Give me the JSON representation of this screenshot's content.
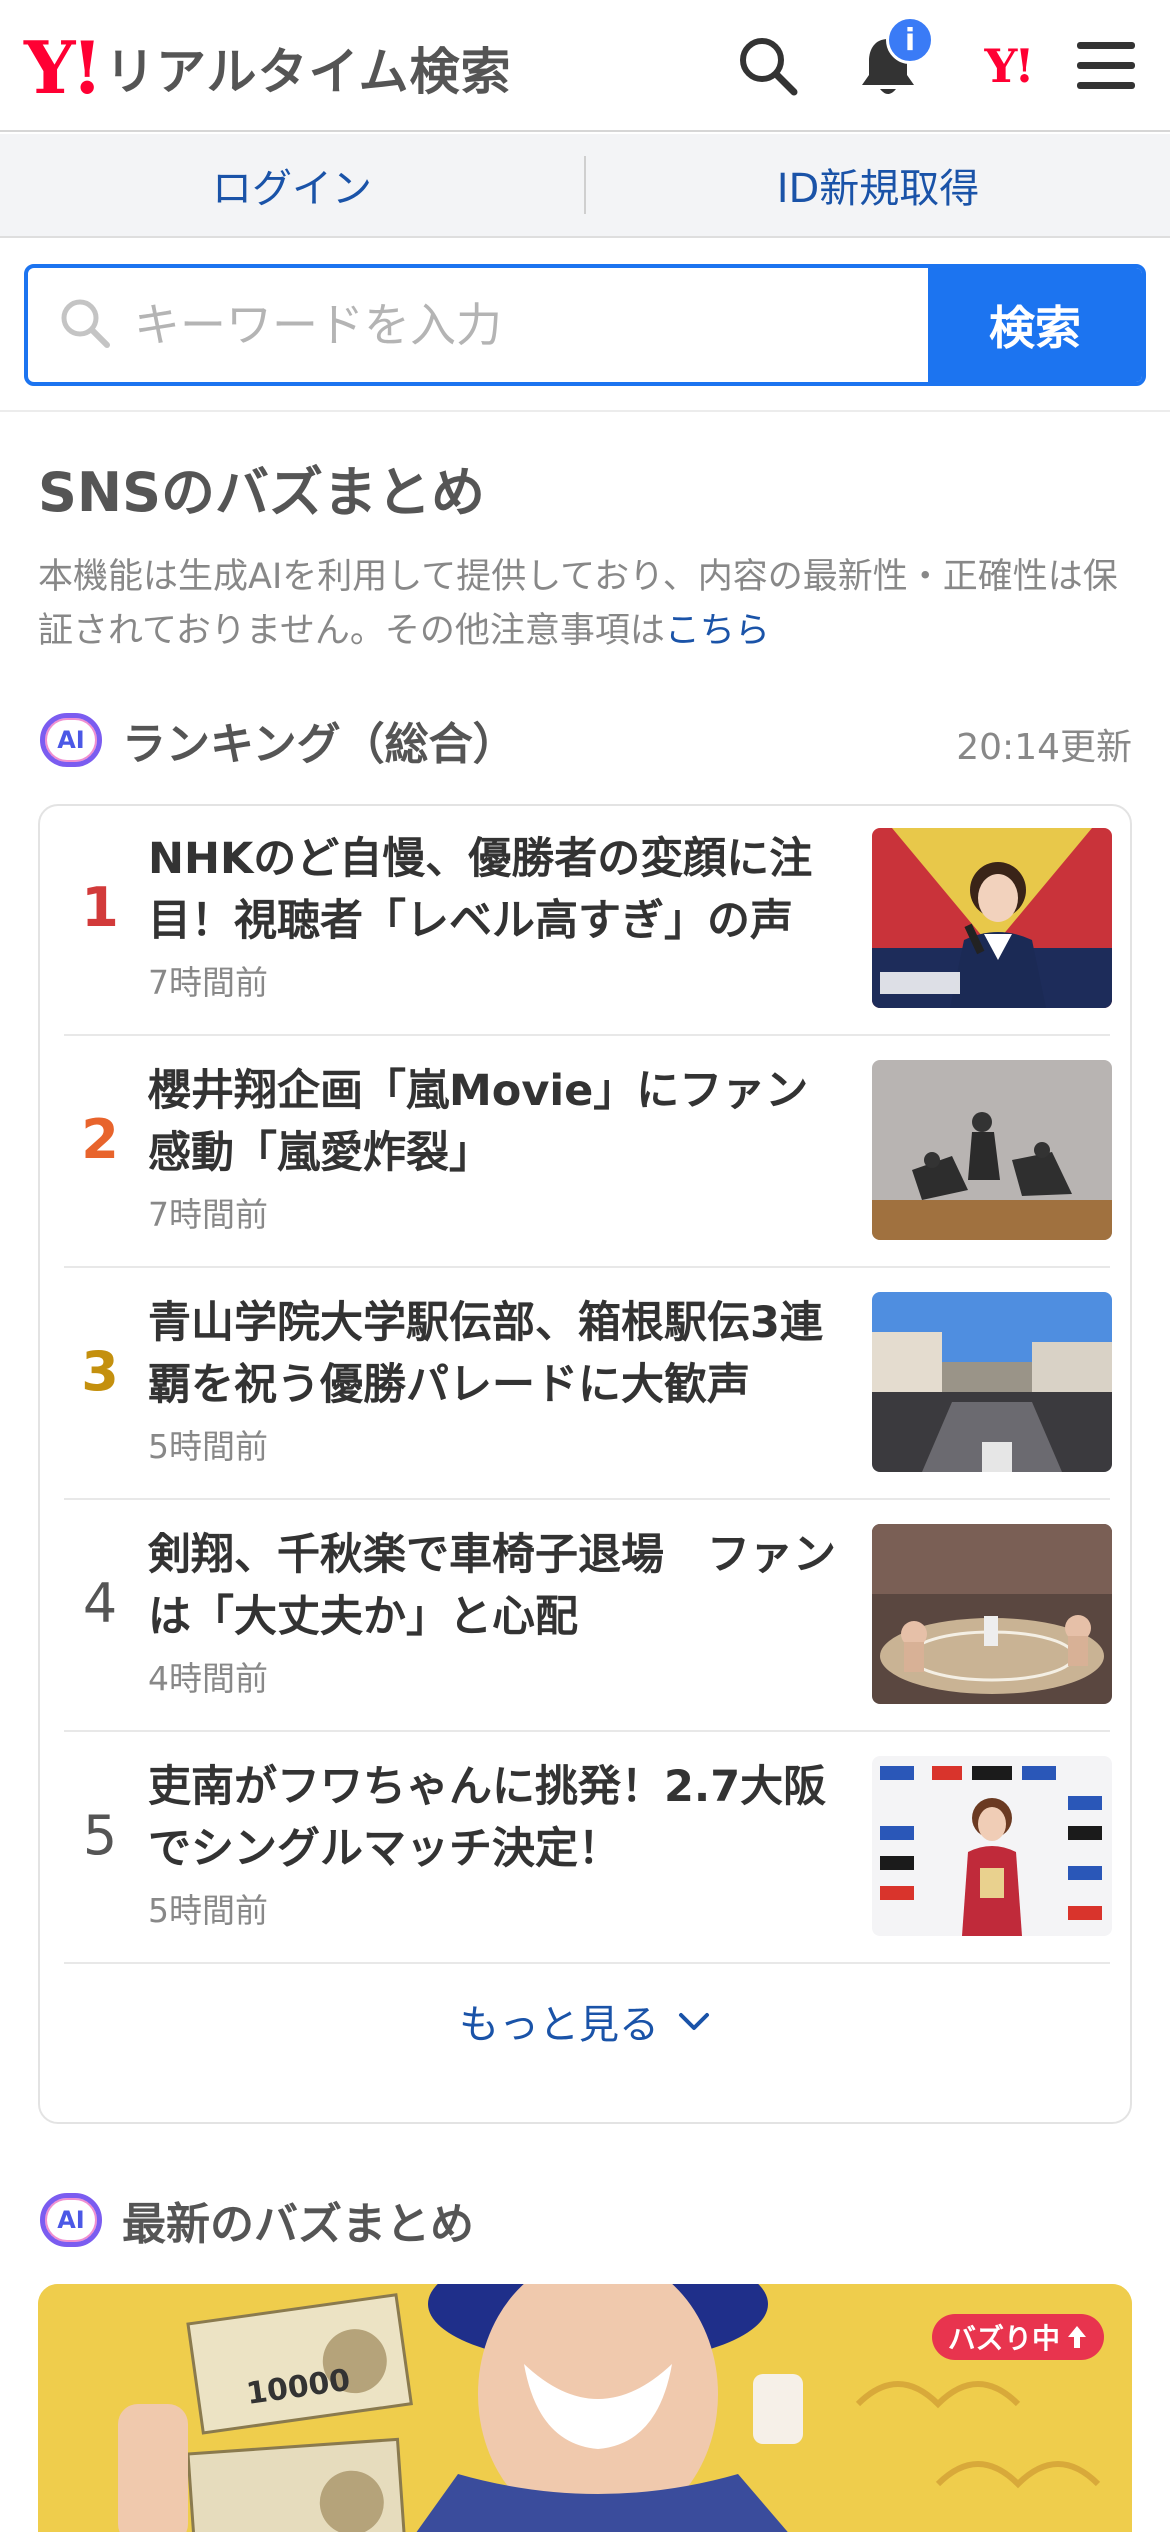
{
  "header": {
    "logo_mark": "Y!",
    "logo_text": "リアルタイム検索",
    "notification_badge": "i",
    "yahoo_mini": "Y!"
  },
  "login_bar": {
    "login": "ログイン",
    "register": "ID新規取得"
  },
  "search": {
    "placeholder": "キーワードを入力",
    "button": "検索"
  },
  "section": {
    "title": "SNSのバズまとめ",
    "notice": "本機能は生成AIを利用して提供しており、内容の最新性・正確性は保証されておりません。その他注意事項は",
    "notice_link": "こちら"
  },
  "ranking": {
    "badge": "AI",
    "title": "ランキング（総合）",
    "updated": "20:14更新",
    "items": [
      {
        "rank": "1",
        "title": "NHKのど自慢、優勝者の変顔に注目！視聴者「レベル高すぎ」の声",
        "time": "7時間前"
      },
      {
        "rank": "2",
        "title": "櫻井翔企画「嵐Movie」にファン感動「嵐愛炸裂」",
        "time": "7時間前"
      },
      {
        "rank": "3",
        "title": "青山学院大学駅伝部、箱根駅伝3連覇を祝う優勝パレードに大歓声",
        "time": "5時間前"
      },
      {
        "rank": "4",
        "title": "剣翔、千秋楽で車椅子退場　ファンは「大丈夫か」と心配",
        "time": "4時間前"
      },
      {
        "rank": "5",
        "title": "吏南がフワちゃんに挑発！2.7大阪でシングルマッチ決定！",
        "time": "5時間前"
      }
    ],
    "more": "もっと見る"
  },
  "latest": {
    "badge": "AI",
    "title": "最新のバズまとめ",
    "buzz_badge": "バズり中",
    "banknote_text": "10000"
  },
  "colors": {
    "rank1": "#d23a3a",
    "rank2": "#e8642c",
    "rank3": "#c4900e",
    "rank_other": "#555555",
    "accent": "#1c74f0",
    "link": "#1a53a8"
  }
}
